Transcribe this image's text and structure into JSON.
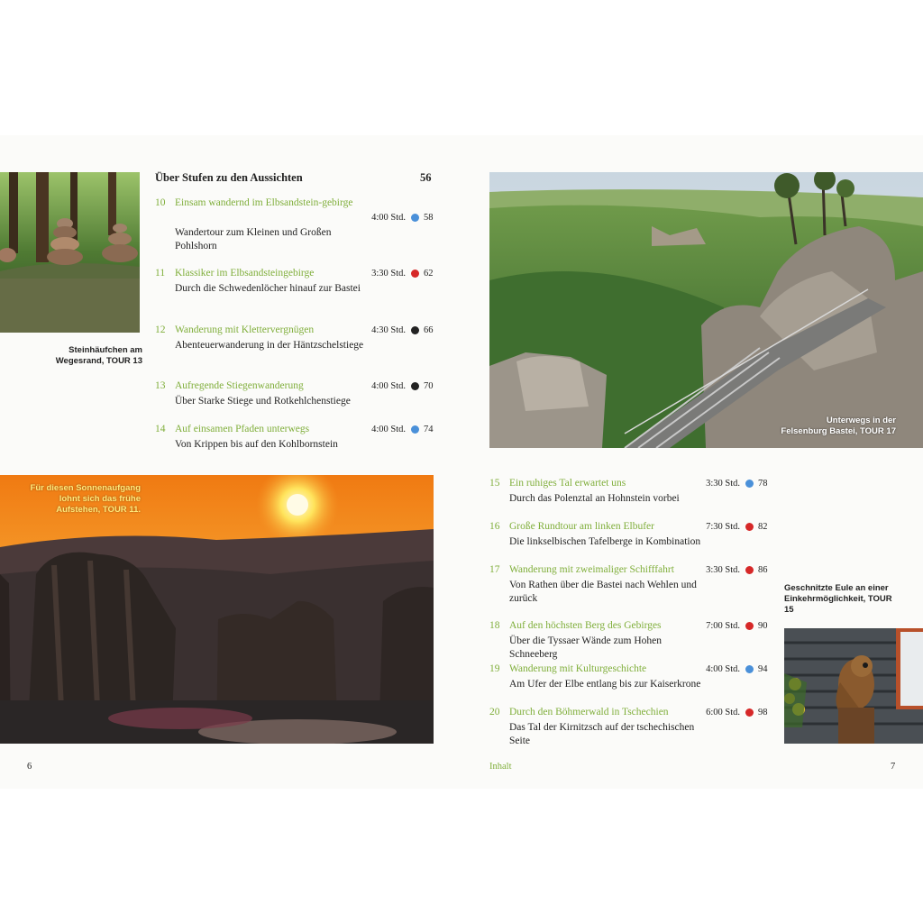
{
  "section": {
    "title": "Über Stufen zu den Aussichten",
    "page": "56"
  },
  "difficulty_colors": {
    "blue": "#4a90d9",
    "red": "#d62828",
    "black": "#222222"
  },
  "tours": [
    {
      "num": "10",
      "title": "Einsam wandernd im Elbsandstein-gebirge",
      "desc": "Wandertour zum Kleinen und Großen Pohlshorn",
      "time": "4:00 Std.",
      "difficulty": "blue",
      "page": "58"
    },
    {
      "num": "11",
      "title": "Klassiker im Elbsandsteingebirge",
      "desc": "Durch die Schwedenlöcher hinauf zur Bastei",
      "time": "3:30 Std.",
      "difficulty": "red",
      "page": "62"
    },
    {
      "num": "12",
      "title": "Wanderung mit Klettervergnügen",
      "desc": "Abenteuerwanderung in der Häntzschelstiege",
      "time": "4:30 Std.",
      "difficulty": "black",
      "page": "66"
    },
    {
      "num": "13",
      "title": "Aufregende Stiegenwanderung",
      "desc": "Über Starke Stiege und Rotkehlchenstiege",
      "time": "4:00 Std.",
      "difficulty": "black",
      "page": "70"
    },
    {
      "num": "14",
      "title": "Auf einsamen Pfaden unterwegs",
      "desc": "Von Krippen bis auf den Kohlbornstein",
      "time": "4:00 Std.",
      "difficulty": "blue",
      "page": "74"
    },
    {
      "num": "15",
      "title": "Ein ruhiges Tal erwartet uns",
      "desc": "Durch das Polenztal an Hohnstein vorbei",
      "time": "3:30 Std.",
      "difficulty": "blue",
      "page": "78"
    },
    {
      "num": "16",
      "title": "Große Rundtour am linken Elbufer",
      "desc": "Die linkselbischen Tafelberge in Kombination",
      "time": "7:30 Std.",
      "difficulty": "red",
      "page": "82"
    },
    {
      "num": "17",
      "title": "Wanderung mit zweimaliger Schifffahrt",
      "desc": "Von Rathen über die Bastei nach Wehlen und zurück",
      "time": "3:30 Std.",
      "difficulty": "red",
      "page": "86"
    },
    {
      "num": "18",
      "title": "Auf den höchsten Berg des Gebirges",
      "desc": "Über die Tyssaer Wände zum Hohen Schneeberg",
      "time": "7:00 Std.",
      "difficulty": "red",
      "page": "90"
    },
    {
      "num": "19",
      "title": "Wanderung mit Kulturgeschichte",
      "desc": "Am Ufer der Elbe entlang bis zur Kaiserkrone",
      "time": "4:00 Std.",
      "difficulty": "blue",
      "page": "94"
    },
    {
      "num": "20",
      "title": "Durch den Böhmerwald in Tschechien",
      "desc": "Das Tal der Kirnitzsch auf der tschechischen Seite",
      "time": "6:00 Std.",
      "difficulty": "red",
      "page": "98"
    }
  ],
  "captions": {
    "stones": "Steinhäufchen am Wegesrand, TOUR 13",
    "bastei": "Unterwegs in der Felsenburg Bastei, TOUR 17",
    "sunrise": "Für diesen Sonnenaufgang lohnt sich das frühe Aufstehen, TOUR 11.",
    "owl": "Geschnitzte Eule an einer Einkehrmöglichkeit, TOUR 15"
  },
  "footer": {
    "left_page": "6",
    "section_label": "Inhalt",
    "right_page": "7"
  }
}
